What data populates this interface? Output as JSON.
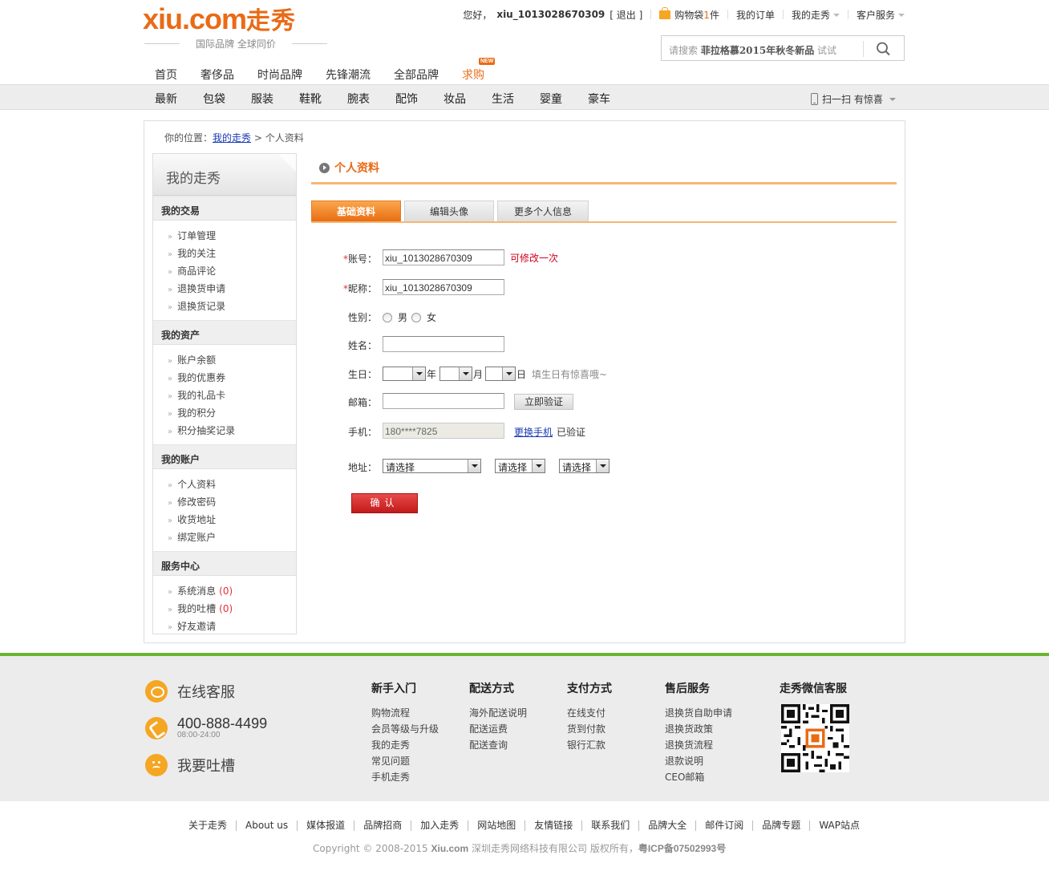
{
  "logo": {
    "brand_en": "xiu.com",
    "brand_cn": "走秀",
    "slogan": "国际品牌   全球同价"
  },
  "topbar": {
    "greeting": "您好，",
    "username": "xiu_1013028670309",
    "logout": "[ 退出 ]",
    "cart_label": "购物袋",
    "cart_count": "1",
    "cart_unit": "件",
    "my_orders": "我的订单",
    "my_xiu": "我的走秀",
    "customer_service": "客户服务"
  },
  "search": {
    "placeholder_prefix": "请搜索 ",
    "placeholder_keyword": "菲拉格慕2015年秋冬新品",
    "placeholder_suffix": " 试试"
  },
  "main_nav": [
    {
      "label": "首页"
    },
    {
      "label": "奢侈品"
    },
    {
      "label": "时尚品牌"
    },
    {
      "label": "先锋潮流"
    },
    {
      "label": "全部品牌"
    },
    {
      "label": "求购",
      "badge": "NEW",
      "highlight": true
    }
  ],
  "category_nav": [
    "最新",
    "包袋",
    "服装",
    "鞋靴",
    "腕表",
    "配饰",
    "妆品",
    "生活",
    "婴童",
    "豪车"
  ],
  "scan_text": "扫一扫 有惊喜",
  "breadcrumb": {
    "prefix": "你的位置：",
    "link": "我的走秀",
    "sep": " > ",
    "current": "个人资料"
  },
  "sidebar": {
    "title": "我的走秀",
    "sections": [
      {
        "title": "我的交易",
        "items": [
          {
            "label": "订单管理"
          },
          {
            "label": "我的关注"
          },
          {
            "label": "商品评论"
          },
          {
            "label": "退换货申请"
          },
          {
            "label": "退换货记录"
          }
        ]
      },
      {
        "title": "我的资产",
        "items": [
          {
            "label": "账户余额"
          },
          {
            "label": "我的优惠券"
          },
          {
            "label": "我的礼品卡"
          },
          {
            "label": "我的积分"
          },
          {
            "label": "积分抽奖记录"
          }
        ]
      },
      {
        "title": "我的账户",
        "items": [
          {
            "label": "个人资料"
          },
          {
            "label": "修改密码"
          },
          {
            "label": "收货地址"
          },
          {
            "label": "绑定账户"
          }
        ]
      },
      {
        "title": "服务中心",
        "items": [
          {
            "label": "系统消息",
            "count": "(0)"
          },
          {
            "label": "我的吐槽",
            "count": "(0)"
          },
          {
            "label": "好友邀请"
          }
        ]
      }
    ]
  },
  "page_title": "个人资料",
  "tabs": [
    "基础资料",
    "编辑头像",
    "更多个人信息"
  ],
  "form": {
    "account_label": "账号：",
    "account_value": "xiu_1013028670309",
    "account_note": "可修改一次",
    "nickname_label": "昵称：",
    "nickname_value": "xiu_1013028670309",
    "gender_label": "性别：",
    "gender_male": "男",
    "gender_female": "女",
    "name_label": "姓名：",
    "name_value": "",
    "birthday_label": "生日：",
    "birthday_year_unit": "年",
    "birthday_month_unit": "月",
    "birthday_day_unit": "日",
    "birthday_note": "填生日有惊喜哦~",
    "email_label": "邮箱：",
    "email_value": "",
    "verify_button": "立即验证",
    "phone_label": "手机：",
    "phone_value": "180****7825",
    "change_phone": "更换手机",
    "phone_status": "已验证",
    "address_label": "地址：",
    "province": "请选择",
    "city": "请选择",
    "district": "请选择",
    "submit": "确认"
  },
  "footer": {
    "online_service": "在线客服",
    "hotline": "400-888-4499",
    "hours": "08:00-24:00",
    "complaint": "我要吐槽",
    "columns": [
      {
        "title": "新手入门",
        "items": [
          "购物流程",
          "会员等级与升级",
          "我的走秀",
          "常见问题",
          "手机走秀"
        ]
      },
      {
        "title": "配送方式",
        "items": [
          "海外配送说明",
          "配送运费",
          "配送查询"
        ]
      },
      {
        "title": "支付方式",
        "items": [
          "在线支付",
          "货到付款",
          "银行汇款"
        ]
      },
      {
        "title": "售后服务",
        "items": [
          "退换货自助申请",
          "退换货政策",
          "退换货流程",
          "退款说明",
          "CEO邮箱"
        ]
      }
    ],
    "wechat_title": "走秀微信客服",
    "bottom_links": [
      "关于走秀",
      "About us",
      "媒体报道",
      "品牌招商",
      "加入走秀",
      "网站地图",
      "友情链接",
      "联系我们",
      "品牌大全",
      "邮件订阅",
      "品牌专题",
      "WAP站点"
    ],
    "copyright_prefix": "Copyright © 2008-2015 ",
    "copyright_domain": "Xiu.com",
    "copyright_company": " 深圳走秀网络科技有限公司 版权所有，",
    "icp": "粤ICP备07502993号"
  },
  "colors": {
    "brand_orange": "#e96b16",
    "footer_green": "#6ab42f",
    "alert_red": "#d0021b",
    "submit_red": "#c21a1a"
  }
}
